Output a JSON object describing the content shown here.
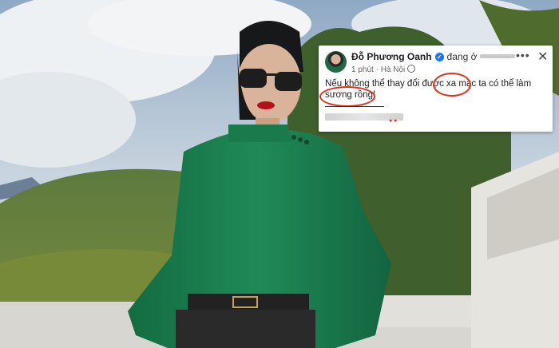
{
  "post": {
    "author": "Đỗ Phương Oanh",
    "status": "đang ở",
    "time": "1 phút",
    "location": "Hà Nội",
    "text": "Nếu không thể thay đổi được xa mạc ta có thể làm sương rồng!",
    "more_icon": "•••",
    "close_icon": "✕"
  },
  "colors": {
    "annotation_circle": "#e0321c",
    "blouse": "#1f8a57",
    "verified_badge": "#1877f2"
  }
}
